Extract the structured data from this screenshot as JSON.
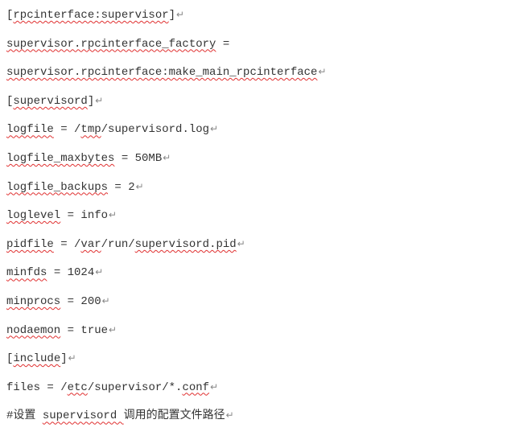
{
  "lines": {
    "l1_open": "[",
    "l1_spell": "rpcinterface:supervisor",
    "l1_close": "]",
    "l2_spell": "supervisor.rpcinterface_factory",
    "l2_rest": " =",
    "l3_spell": "supervisor.rpcinterface:make_main_rpcinterface",
    "l4_open": "[",
    "l4_spell": "supervisord",
    "l4_close": "]",
    "l5_spell": "logfile",
    "l5_mid1": " = /",
    "l5_spell2": "tmp",
    "l5_rest": "/supervisord.log",
    "l6_spell": "logfile_maxbytes",
    "l6_rest": " = 50MB",
    "l7_spell": "logfile_backups",
    "l7_rest": " = 2",
    "l8_spell": "loglevel",
    "l8_rest": " = info",
    "l9_spell": "pidfile",
    "l9_mid1": " = /",
    "l9_spell2": "var",
    "l9_mid2": "/run/",
    "l9_spell3": "supervisord.pid",
    "l10_spell": "minfds",
    "l10_rest": " = 1024",
    "l11_spell": "minprocs",
    "l11_rest": " = 200",
    "l12_spell": "nodaemon",
    "l12_rest": " = true",
    "l13_open": "[",
    "l13_spell": "include",
    "l13_close": "]",
    "l14_pre": "files",
    "l14_mid1": " = /",
    "l14_spell": "etc",
    "l14_mid2": "/supervisor/*.",
    "l14_spell2": "conf",
    "l15_pre": "#设置 ",
    "l15_spell": "supervisord ",
    "l15_rest": "调用的配置文件路径"
  },
  "return_mark": "↵"
}
